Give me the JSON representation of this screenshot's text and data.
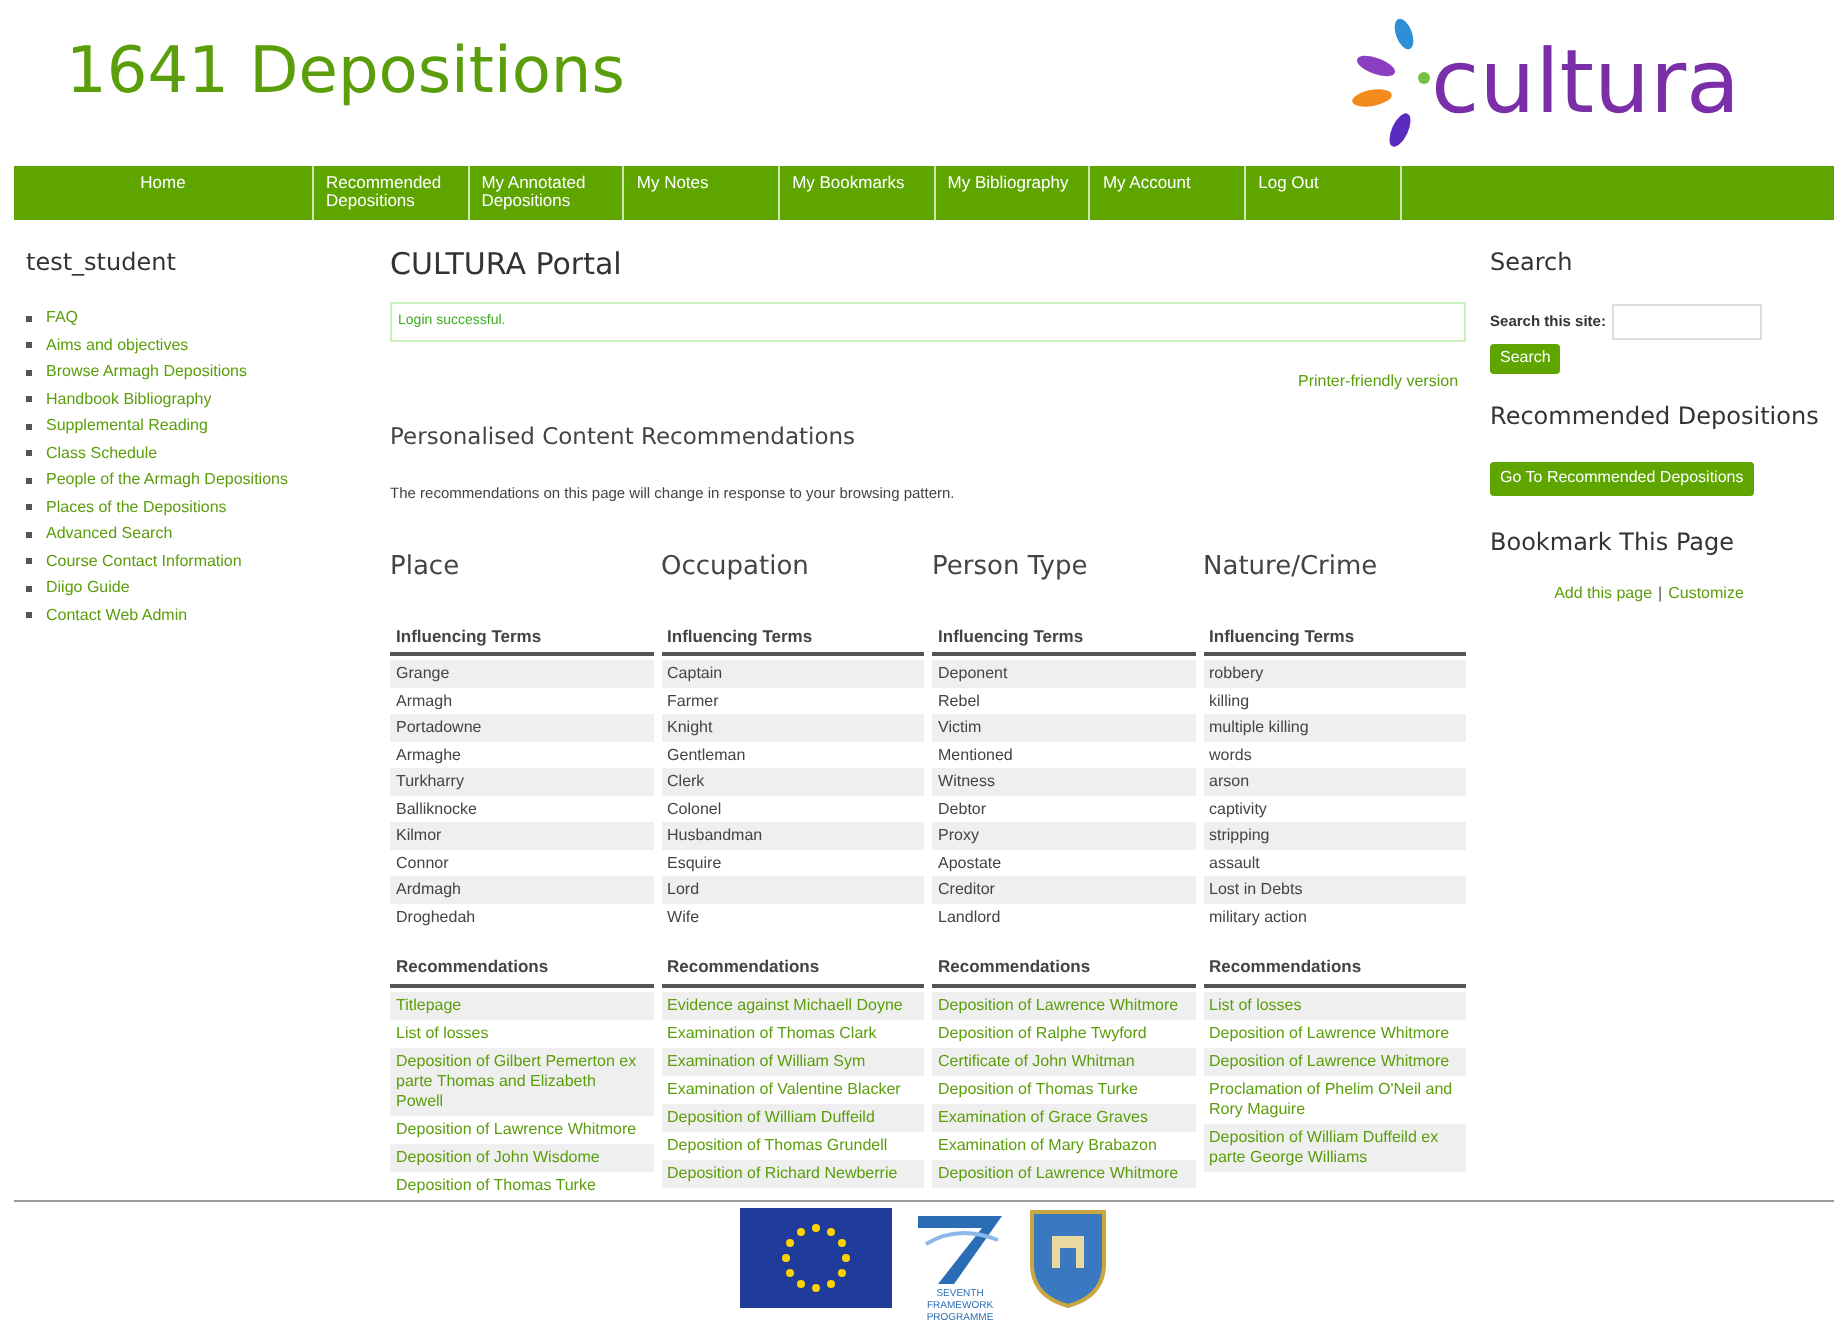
{
  "site": {
    "title": "1641 Depositions",
    "logo_text": "cultura"
  },
  "nav": [
    {
      "label": "Home"
    },
    {
      "label": "Recommended Depositions"
    },
    {
      "label": "My Annotated Depositions"
    },
    {
      "label": "My Notes"
    },
    {
      "label": "My Bookmarks"
    },
    {
      "label": "My Bibliography"
    },
    {
      "label": "My Account"
    },
    {
      "label": "Log Out"
    }
  ],
  "user_menu": {
    "title": "test_student",
    "links": [
      "FAQ",
      "Aims and objectives",
      "Browse Armagh Depositions",
      "Handbook Bibliography",
      "Supplemental Reading",
      "Class Schedule",
      "People of the Armagh Depositions",
      "Places of the Depositions",
      "Advanced Search",
      "Course Contact Information",
      "Diigo Guide",
      "Contact Web Admin"
    ]
  },
  "main": {
    "title": "CULTURA Portal",
    "message": "Login successful.",
    "printer_link": "Printer-friendly version",
    "section_title": "Personalised Content Recommendations",
    "intro": "The recommendations on this page will change in response to your browsing pattern.",
    "columns": [
      {
        "title": "Place",
        "terms_header": "Influencing Terms",
        "terms": [
          "Grange",
          "Armagh",
          "Portadowne",
          "Armaghe",
          "Turkharry",
          "Balliknocke",
          "Kilmor",
          "Connor",
          "Ardmagh",
          "Droghedah"
        ],
        "recs_header": "Recommendations",
        "recommendations": [
          "Titlepage",
          "List of losses",
          "Deposition of Gilbert Pemerton ex parte Thomas and Elizabeth Powell",
          "Deposition of Lawrence Whitmore",
          "Deposition of John Wisdome",
          "Deposition of Thomas Turke"
        ]
      },
      {
        "title": "Occupation",
        "terms_header": "Influencing Terms",
        "terms": [
          "Captain",
          "Farmer",
          "Knight",
          "Gentleman",
          "Clerk",
          "Colonel",
          "Husbandman",
          "Esquire",
          "Lord",
          "Wife"
        ],
        "recs_header": "Recommendations",
        "recommendations": [
          "Evidence against Michaell Doyne",
          "Examination of Thomas Clark",
          "Examination of William Sym",
          "Examination of Valentine Blacker",
          "Deposition of William Duffeild",
          "Deposition of Thomas Grundell",
          "Deposition of Richard Newberrie"
        ]
      },
      {
        "title": "Person Type",
        "terms_header": "Influencing Terms",
        "terms": [
          "Deponent",
          "Rebel",
          "Victim",
          "Mentioned",
          "Witness",
          "Debtor",
          "Proxy",
          "Apostate",
          "Creditor",
          "Landlord"
        ],
        "recs_header": "Recommendations",
        "recommendations": [
          "Deposition of Lawrence Whitmore",
          "Deposition of Ralphe Twyford",
          "Certificate of John Whitman",
          "Deposition of Thomas Turke",
          "Examination of Grace Graves",
          "Examination of Mary Brabazon",
          "Deposition of Lawrence Whitmore"
        ]
      },
      {
        "title": "Nature/Crime",
        "terms_header": "Influencing Terms",
        "terms": [
          "robbery",
          "killing",
          "multiple killing",
          "words",
          "arson",
          "captivity",
          "stripping",
          "assault",
          "Lost in Debts",
          "military action"
        ],
        "recs_header": "Recommendations",
        "recommendations": [
          "List of losses",
          "Deposition of Lawrence Whitmore",
          "Deposition of Lawrence Whitmore",
          "Proclamation of Phelim O'Neil and Rory Maguire",
          "Deposition of William Duffeild ex parte George Williams"
        ]
      }
    ]
  },
  "right": {
    "search_title": "Search",
    "search_label": "Search this site:",
    "search_button": "Search",
    "rec_title": "Recommended Depositions",
    "rec_button": "Go To Recommended Depositions",
    "bookmark_title": "Bookmark This Page",
    "bookmark_links": [
      "Add this page",
      "Customize"
    ],
    "bookmark_separator": "|"
  },
  "footer": {
    "fp7_caption": "SEVENTH FRAMEWORK PROGRAMME"
  }
}
